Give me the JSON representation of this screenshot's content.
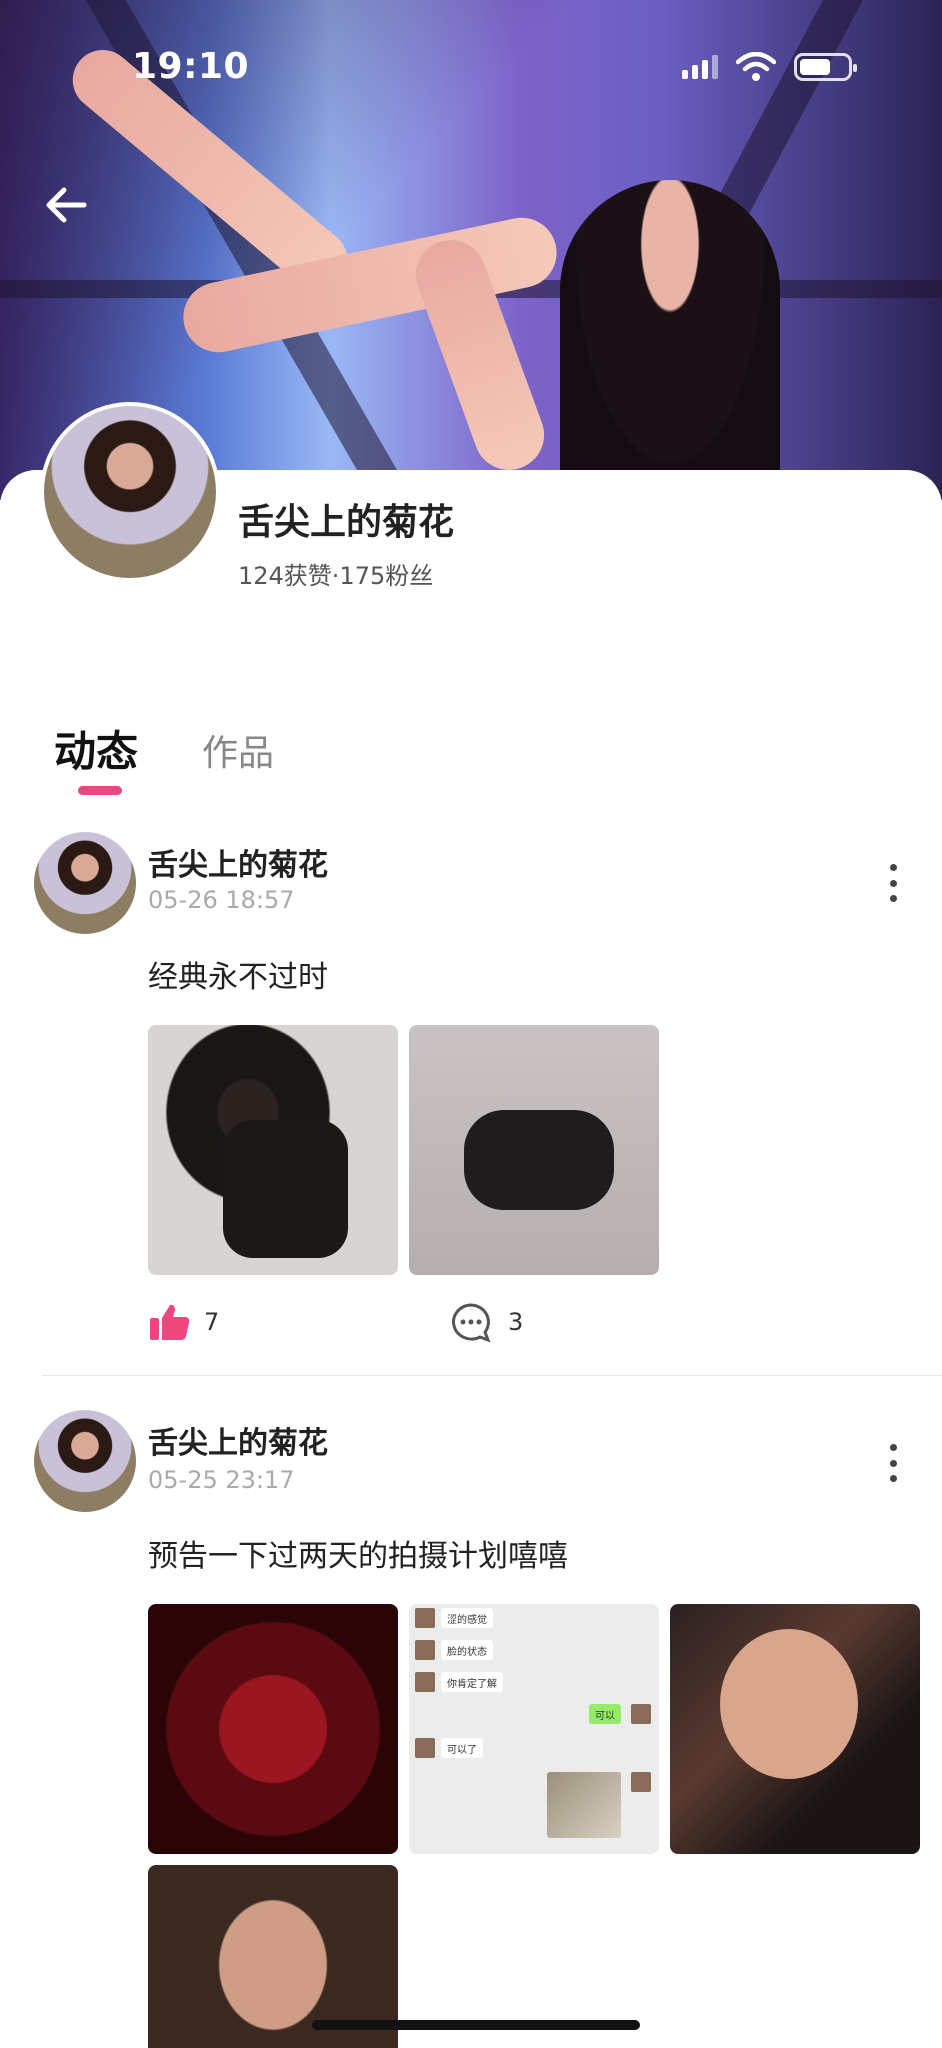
{
  "status_bar": {
    "time": "19:10"
  },
  "profile": {
    "name": "舌尖上的菊花",
    "stats": "124获赞·175粉丝"
  },
  "tabs": [
    {
      "label": "动态",
      "active": true
    },
    {
      "label": "作品",
      "active": false
    }
  ],
  "accent_color": "#f0467e",
  "posts": [
    {
      "author": "舌尖上的菊花",
      "time": "05-26 18:57",
      "text": "经典永不过时",
      "image_count": 2,
      "likes": "7",
      "comments": "3"
    },
    {
      "author": "舌尖上的菊花",
      "time": "05-25 23:17",
      "text": "预告一下过两天的拍摄计划嘻嘻",
      "image_count": 4,
      "chat_screenshot": {
        "messages": [
          "涩的感觉",
          "脸的状态",
          "你肯定了解",
          "可以",
          "可以了"
        ]
      }
    }
  ],
  "icons": {
    "back": "arrow-left-icon",
    "like": "thumbs-up-icon",
    "comment": "comment-bubble-icon",
    "more": "more-vertical-icon",
    "wifi": "wifi-icon",
    "signal": "cellular-signal-icon",
    "battery": "battery-icon"
  }
}
